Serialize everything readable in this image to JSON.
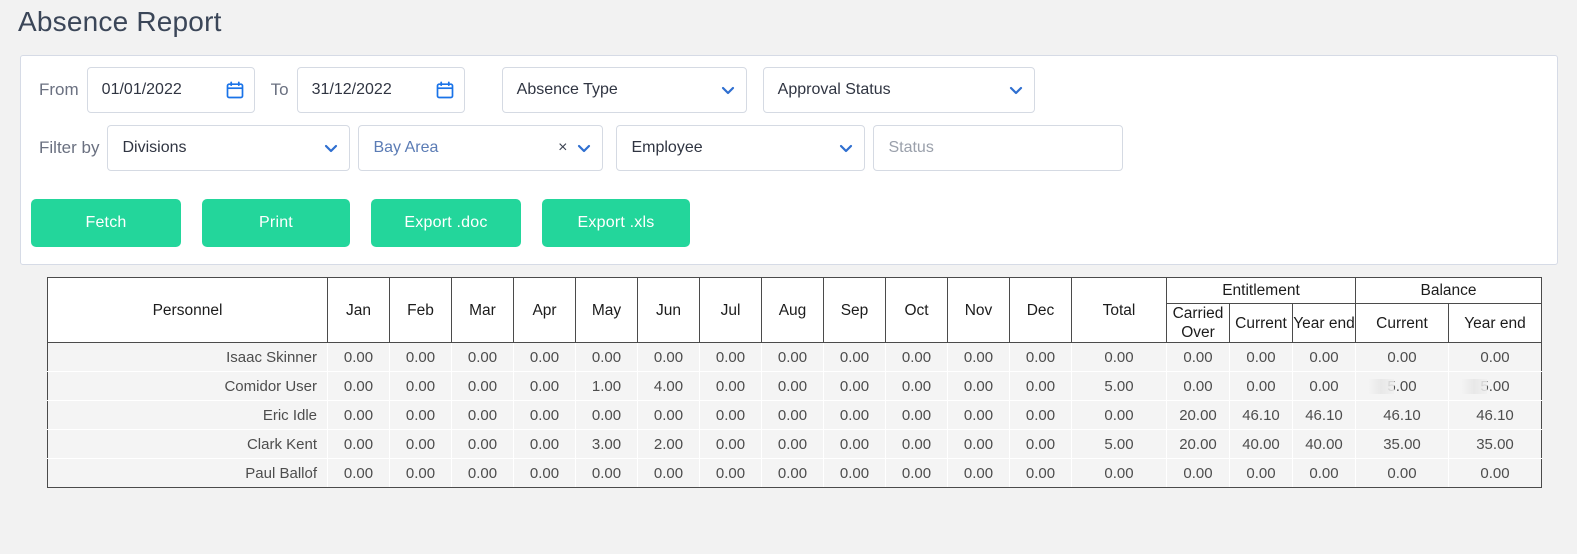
{
  "page_title": "Absence Report",
  "theme": {
    "accent_green": "#23d69b",
    "link_blue": "#2f6fd0",
    "page_bg": "#f2f2f2",
    "title_color": "#3b4658"
  },
  "filters": {
    "from_label": "From",
    "from_value": "01/01/2022",
    "to_label": "To",
    "to_value": "31/12/2022",
    "absence_type": "Absence Type",
    "approval_status": "Approval Status",
    "filter_by_label": "Filter by",
    "divisions": "Divisions",
    "division_chip": "Bay Area",
    "employee": "Employee",
    "status_placeholder": "Status",
    "status_value": ""
  },
  "actions": {
    "fetch": "Fetch",
    "print": "Print",
    "export_doc": "Export .doc",
    "export_xls": "Export .xls"
  },
  "table": {
    "group_headers": {
      "entitlement": "Entitlement",
      "balance": "Balance"
    },
    "columns": [
      "Personnel",
      "Jan",
      "Feb",
      "Mar",
      "Apr",
      "May",
      "Jun",
      "Jul",
      "Aug",
      "Sep",
      "Oct",
      "Nov",
      "Dec",
      "Total"
    ],
    "sub_columns": {
      "entitlement": [
        "Carried Over",
        "Current",
        "Year end"
      ],
      "balance": [
        "Current",
        "Year end"
      ]
    },
    "rows": [
      {
        "personnel": "Isaac Skinner",
        "months": [
          "0.00",
          "0.00",
          "0.00",
          "0.00",
          "0.00",
          "0.00",
          "0.00",
          "0.00",
          "0.00",
          "0.00",
          "0.00",
          "0.00"
        ],
        "total": "0.00",
        "entitlement": [
          "0.00",
          "0.00",
          "0.00"
        ],
        "balance": [
          "0.00",
          "0.00"
        ]
      },
      {
        "personnel": "Comidor User",
        "months": [
          "0.00",
          "0.00",
          "0.00",
          "0.00",
          "1.00",
          "4.00",
          "0.00",
          "0.00",
          "0.00",
          "0.00",
          "0.00",
          "0.00"
        ],
        "total": "5.00",
        "entitlement": [
          "0.00",
          "0.00",
          "0.00"
        ],
        "balance": [
          "5.00",
          "5.00"
        ]
      },
      {
        "personnel": "Eric Idle",
        "months": [
          "0.00",
          "0.00",
          "0.00",
          "0.00",
          "0.00",
          "0.00",
          "0.00",
          "0.00",
          "0.00",
          "0.00",
          "0.00",
          "0.00"
        ],
        "total": "0.00",
        "entitlement": [
          "20.00",
          "46.10",
          "46.10"
        ],
        "balance": [
          "46.10",
          "46.10"
        ]
      },
      {
        "personnel": "Clark Kent",
        "months": [
          "0.00",
          "0.00",
          "0.00",
          "0.00",
          "3.00",
          "2.00",
          "0.00",
          "0.00",
          "0.00",
          "0.00",
          "0.00",
          "0.00"
        ],
        "total": "5.00",
        "entitlement": [
          "20.00",
          "40.00",
          "40.00"
        ],
        "balance": [
          "35.00",
          "35.00"
        ]
      },
      {
        "personnel": "Paul Ballof",
        "months": [
          "0.00",
          "0.00",
          "0.00",
          "0.00",
          "0.00",
          "0.00",
          "0.00",
          "0.00",
          "0.00",
          "0.00",
          "0.00",
          "0.00"
        ],
        "total": "0.00",
        "entitlement": [
          "0.00",
          "0.00",
          "0.00"
        ],
        "balance": [
          "0.00",
          "0.00"
        ]
      }
    ]
  },
  "icons": {
    "calendar": "calendar-icon",
    "chevron_down": "chevron-down-icon",
    "clear": "clear-icon"
  }
}
